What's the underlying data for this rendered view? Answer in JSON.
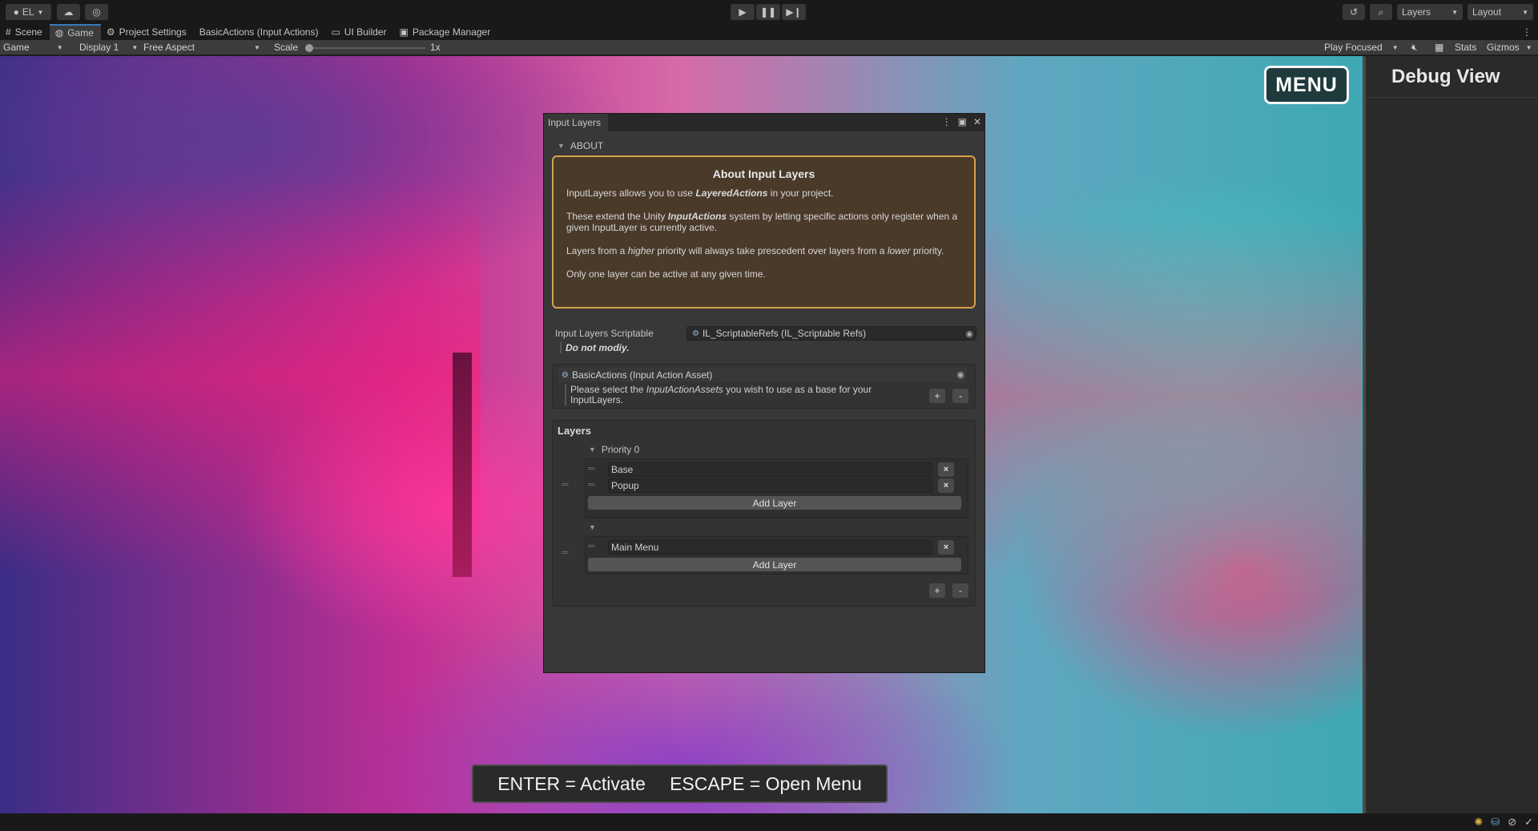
{
  "toolbar": {
    "account_label": "EL",
    "layers_label": "Layers",
    "layout_label": "Layout"
  },
  "tabs": [
    {
      "label": "Scene",
      "icon": "grid-icon"
    },
    {
      "label": "Game",
      "icon": "gamepad-icon"
    },
    {
      "label": "Project Settings",
      "icon": "gear-icon"
    },
    {
      "label": "BasicActions (Input Actions)",
      "icon": ""
    },
    {
      "label": "UI Builder",
      "icon": "window-icon"
    },
    {
      "label": "Package Manager",
      "icon": "package-icon"
    }
  ],
  "gamebar": {
    "mode": "Game",
    "display": "Display 1",
    "aspect": "Free Aspect",
    "scale_label": "Scale",
    "scale_value": "1x",
    "play_mode": "Play Focused",
    "stats": "Stats",
    "gizmos": "Gizmos"
  },
  "game": {
    "menu_button": "MENU",
    "hint_enter": "ENTER = Activate",
    "hint_escape": "ESCAPE = Open Menu"
  },
  "debug": {
    "title": "Debug View"
  },
  "input_layers": {
    "window_title": "Input Layers",
    "about_toggle": "ABOUT",
    "about": {
      "title": "About Input Layers",
      "p1_pre": "InputLayers allows you to use ",
      "p1_em": "LayeredActions",
      "p1_post": " in your project.",
      "p2_pre": "These extend the Unity ",
      "p2_em": "InputActions",
      "p2_post": " system by letting specific actions only register when a given InputLayer is currently active.",
      "p3_pre": "Layers from a ",
      "p3_em1": "higher",
      "p3_mid": " priority will always take prescedent over layers from a ",
      "p3_em2": "lower",
      "p3_post": " priority.",
      "p4": "Only one layer can be active at any given time."
    },
    "scriptable_label": "Input Layers Scriptable",
    "scriptable_value": "IL_ScriptableRefs (IL_Scriptable Refs)",
    "scriptable_note": "Do not modiy.",
    "asset_value": "BasicActions (Input Action Asset)",
    "asset_desc_pre": "Please select the ",
    "asset_desc_em": "InputActionAssets",
    "asset_desc_post": " you wish to use as a base for your InputLayers.",
    "plus": "+",
    "minus": "-",
    "layers_title": "Layers",
    "priority_label": "Priority 0",
    "groups": [
      {
        "layers": [
          "Base",
          "Popup"
        ],
        "add_label": "Add Layer"
      },
      {
        "layers": [
          "Main Menu"
        ],
        "add_label": "Add Layer"
      }
    ],
    "remove_glyph": "×"
  },
  "colors": {
    "accent": "#3a79bb",
    "about_border": "#d6a24a",
    "about_bg": "#4a3a2a"
  }
}
